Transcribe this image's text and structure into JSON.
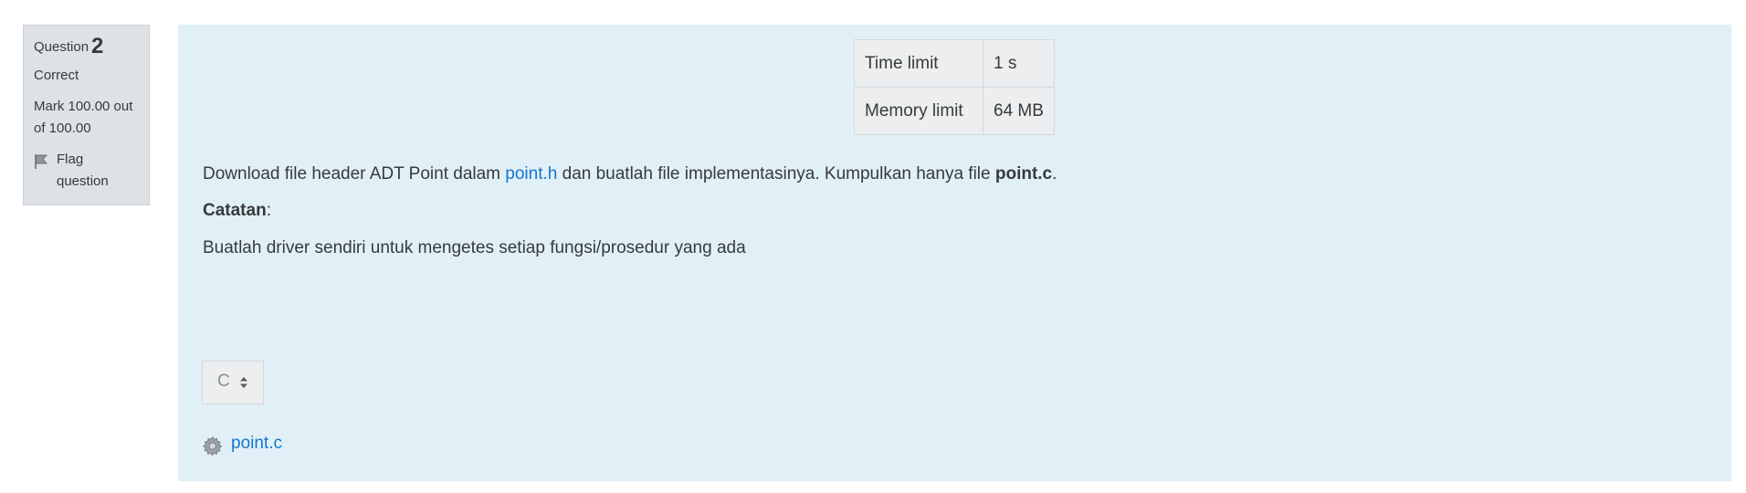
{
  "question_info": {
    "question_label": "Question",
    "question_number": "2",
    "state": "Correct",
    "grade_line1": "Mark 100.00 out",
    "grade_line2": "of 100.00",
    "flag_line1": "Flag",
    "flag_line2": "question",
    "flag_icon": "flag-icon",
    "background_color": "#dee2e6"
  },
  "limits": {
    "time_label": "Time limit",
    "time_value": "1 s",
    "memory_label": "Memory limit",
    "memory_value": "64 MB"
  },
  "question_text": {
    "line1_prefix": "Download file header ADT Point dalam ",
    "line1_link": "point.h",
    "line1_middle": " dan buatlah file implementasinya. Kumpulkan hanya file ",
    "line1_bold": "point.c",
    "line1_suffix": ".",
    "note_label": "Catatan",
    "note_colon": ":",
    "line3": "Buatlah driver sendiri untuk mengetes setiap fungsi/prosedur yang ada"
  },
  "language_select": {
    "value": "C",
    "icon": "sort-arrows-icon"
  },
  "attachment": {
    "icon": "gear-icon",
    "filename": "point.c"
  },
  "colors": {
    "content_background": "#e1f0f7",
    "link": "#1177d1",
    "text": "#373a3c"
  }
}
